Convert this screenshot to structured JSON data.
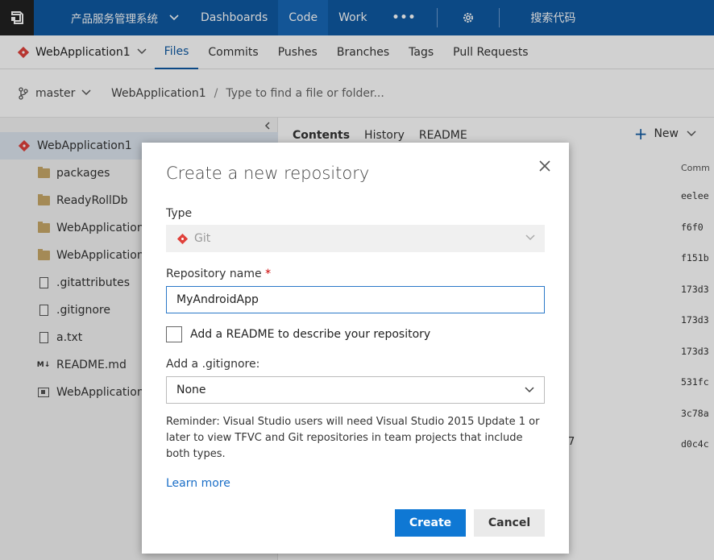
{
  "topbar": {
    "project": "产品服务管理系统",
    "nav": [
      "Dashboards",
      "Code",
      "Work"
    ],
    "active": "Code",
    "more": "•••",
    "search_label": "搜索代码"
  },
  "subnav": {
    "repo": "WebApplication1",
    "tabs": [
      "Files",
      "Commits",
      "Pushes",
      "Branches",
      "Tags",
      "Pull Requests"
    ],
    "active": "Files"
  },
  "pathbar": {
    "branch": "master",
    "repo": "WebApplication1",
    "separator": "/",
    "placeholder": "Type to find a file or folder..."
  },
  "tree": {
    "root": "WebApplication1",
    "items": [
      {
        "name": "packages",
        "kind": "folder"
      },
      {
        "name": "ReadyRollDb",
        "kind": "folder"
      },
      {
        "name": "WebApplication1",
        "kind": "folder"
      },
      {
        "name": "WebApplication1",
        "kind": "folder"
      },
      {
        "name": ".gitattributes",
        "kind": "file"
      },
      {
        "name": ".gitignore",
        "kind": "file"
      },
      {
        "name": "a.txt",
        "kind": "file"
      },
      {
        "name": "README.md",
        "kind": "markdown"
      },
      {
        "name": "WebApplication1",
        "kind": "project"
      }
    ]
  },
  "content": {
    "tabs": [
      "Contents",
      "History",
      "README"
    ],
    "new_label": "New",
    "commit_header": "Comm",
    "commit_ids": [
      "eelee",
      "f6f0",
      "f151b",
      "173d3",
      "173d3",
      "173d3",
      "531fc",
      "3c78a",
      "d0c4c"
    ],
    "stray": "7"
  },
  "dialog": {
    "title": "Create a new repository",
    "close": "×",
    "type_label": "Type",
    "type_value": "Git",
    "name_label": "Repository name",
    "name_required": "*",
    "name_value": "MyAndroidApp",
    "readme_label": "Add a README to describe your repository",
    "gitignore_label": "Add a .gitignore:",
    "gitignore_value": "None",
    "reminder": "Reminder: Visual Studio users will need Visual Studio 2015 Update 1 or later to view TFVC and Git repositories in team projects that include both types.",
    "learn_more": "Learn more",
    "create": "Create",
    "cancel": "Cancel"
  },
  "colors": {
    "topbar": "#0f5aa3",
    "accent": "#0f78d4",
    "git": "#e0413b",
    "folder": "#c8a96a"
  }
}
